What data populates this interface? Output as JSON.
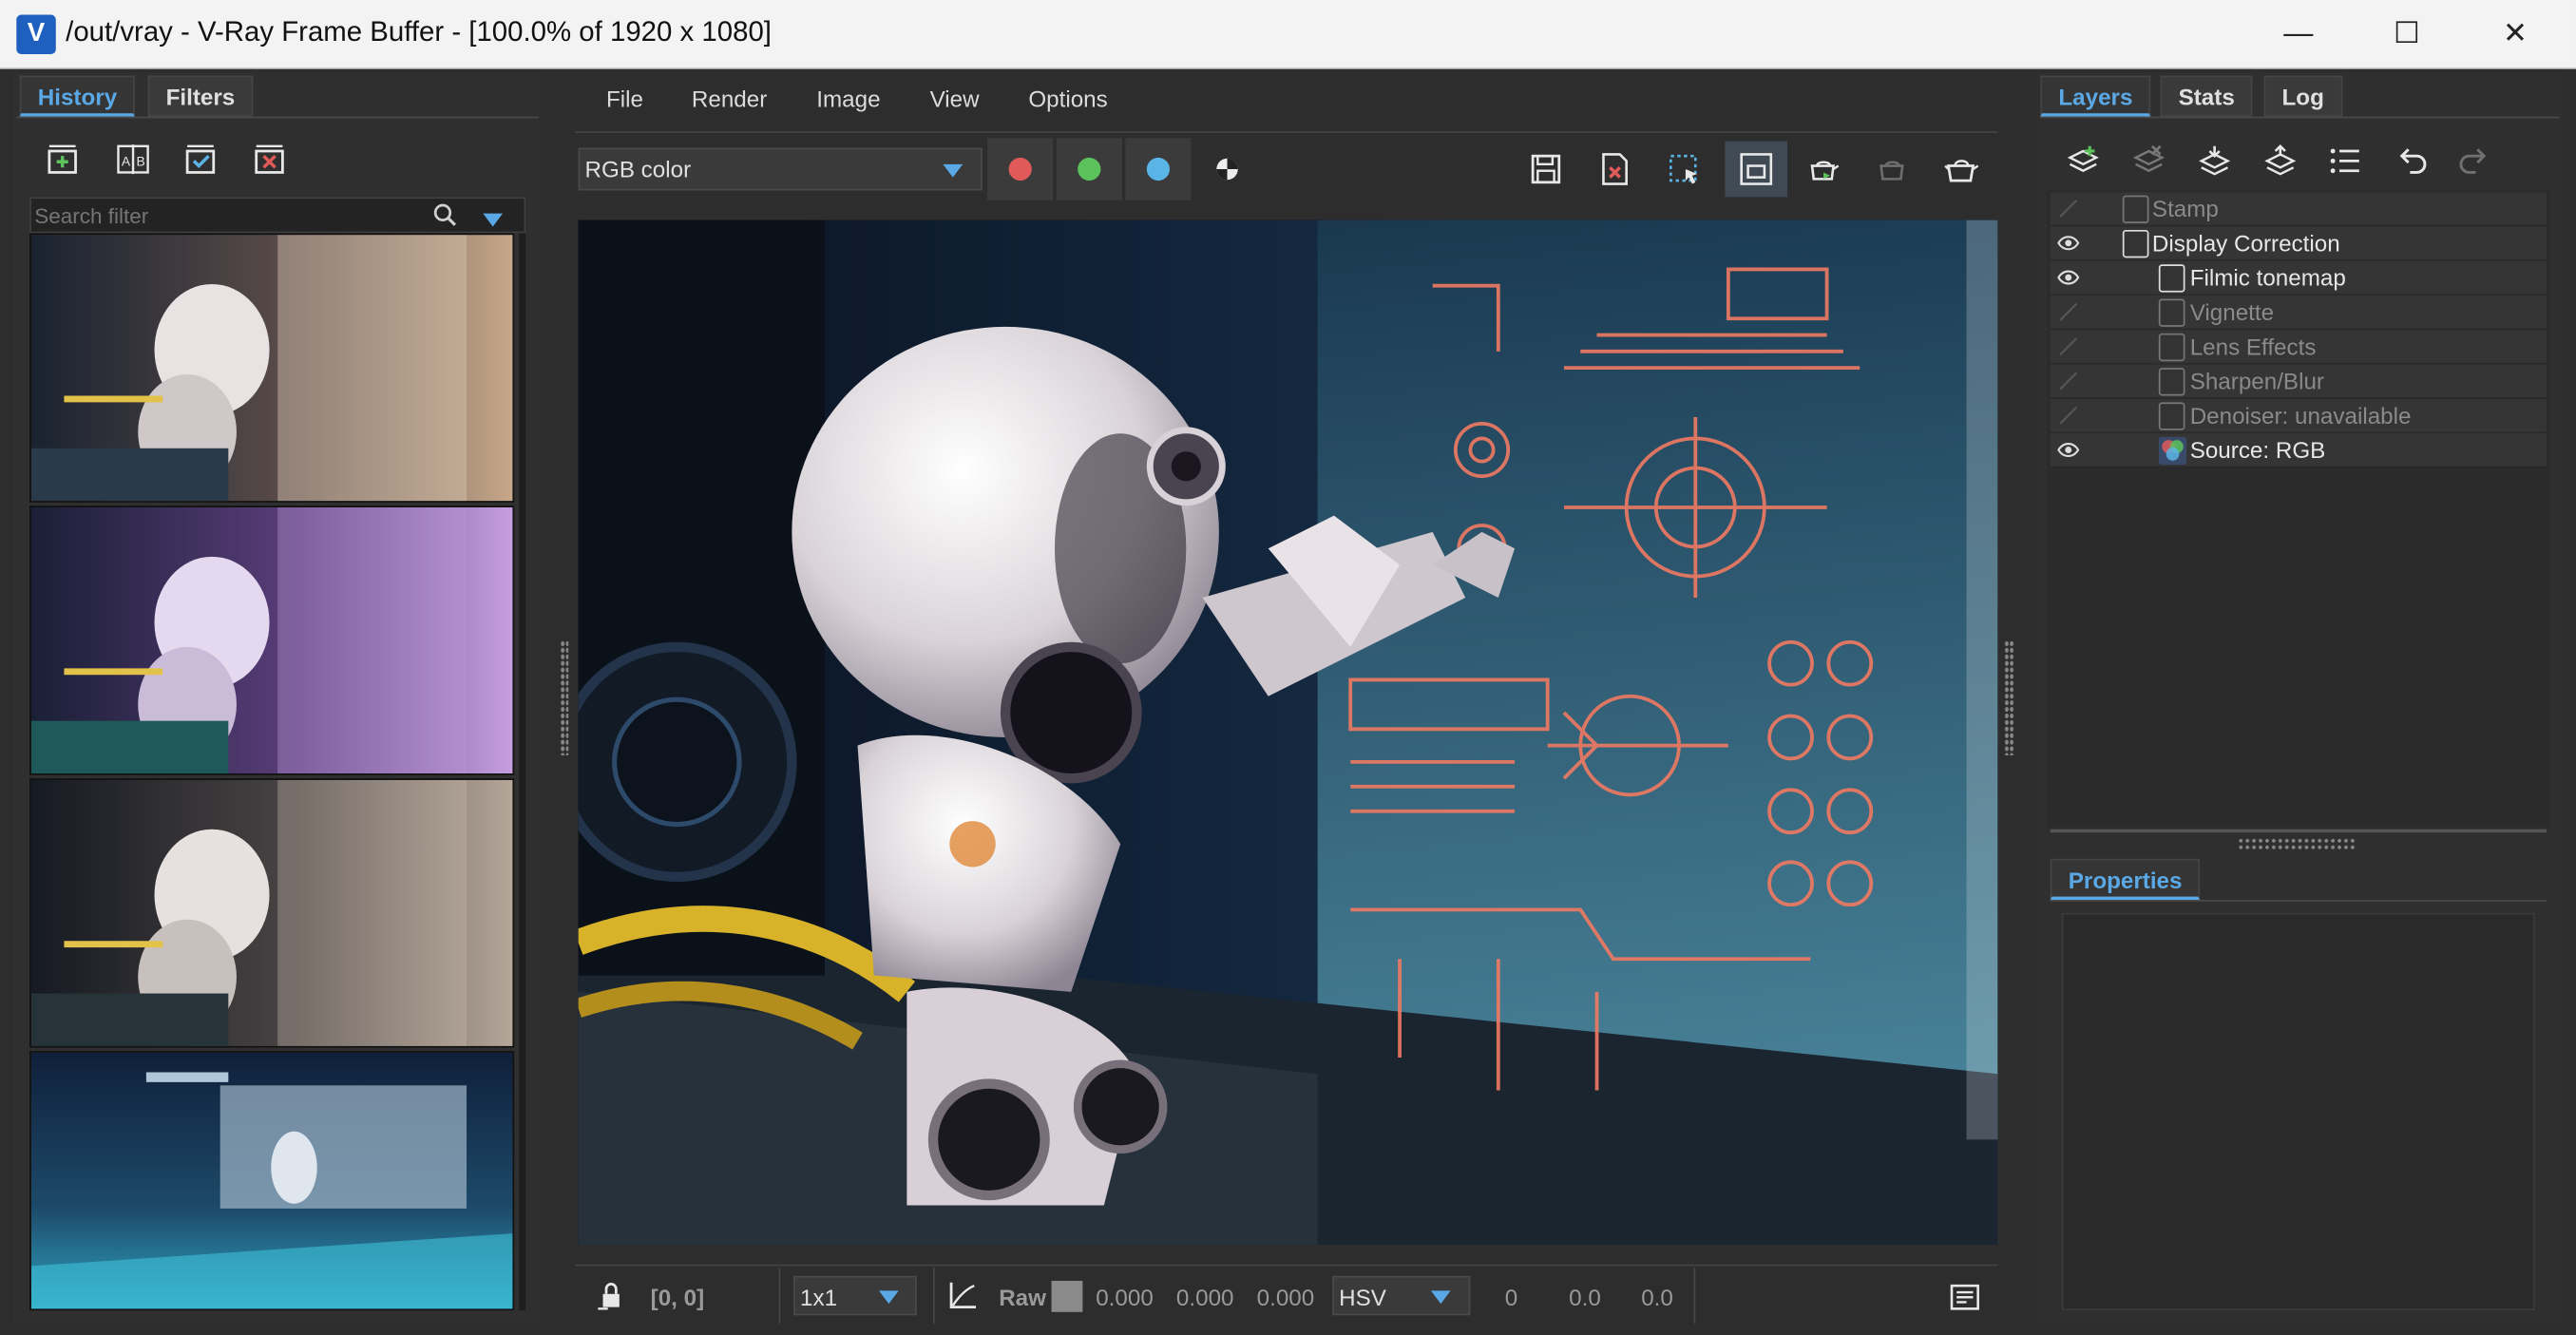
{
  "window": {
    "title": "/out/vray - V-Ray Frame Buffer - [100.0% of 1920 x 1080]",
    "app_icon": "V",
    "minimize": "—",
    "maximize": "☐",
    "close": "✕"
  },
  "left_panel": {
    "tabs": [
      {
        "label": "History"
      },
      {
        "label": "Filters"
      }
    ],
    "search_placeholder": "Search filter"
  },
  "menu": {
    "items": [
      {
        "label": "File"
      },
      {
        "label": "Render"
      },
      {
        "label": "Image"
      },
      {
        "label": "View"
      },
      {
        "label": "Options"
      }
    ]
  },
  "toolbar": {
    "channel_select": "RGB color",
    "colors": {
      "red": "#e05a5a",
      "green": "#5cc35c",
      "blue": "#5ab4e6",
      "accent": "#5aa9e6"
    }
  },
  "statusbar": {
    "coords": "[0, 0]",
    "sample": "1x1",
    "raw_label": "Raw",
    "rgb_values": [
      "0.000",
      "0.000",
      "0.000"
    ],
    "color_mode": "HSV",
    "hsv_values": [
      "0",
      "0.0",
      "0.0"
    ]
  },
  "right_panel": {
    "tabs": [
      {
        "label": "Layers"
      },
      {
        "label": "Stats"
      },
      {
        "label": "Log"
      }
    ],
    "layers": [
      {
        "label": "Stamp",
        "visible": false,
        "indent": 0
      },
      {
        "label": "Display Correction",
        "visible": true,
        "indent": 0
      },
      {
        "label": "Filmic tonemap",
        "visible": true,
        "indent": 1
      },
      {
        "label": "Vignette",
        "visible": false,
        "indent": 1
      },
      {
        "label": "Lens Effects",
        "visible": false,
        "indent": 1
      },
      {
        "label": "Sharpen/Blur",
        "visible": false,
        "indent": 1
      },
      {
        "label": "Denoiser: unavailable",
        "visible": false,
        "indent": 1
      },
      {
        "label": "Source: RGB",
        "visible": true,
        "indent": 1
      }
    ],
    "properties_tab": "Properties"
  }
}
